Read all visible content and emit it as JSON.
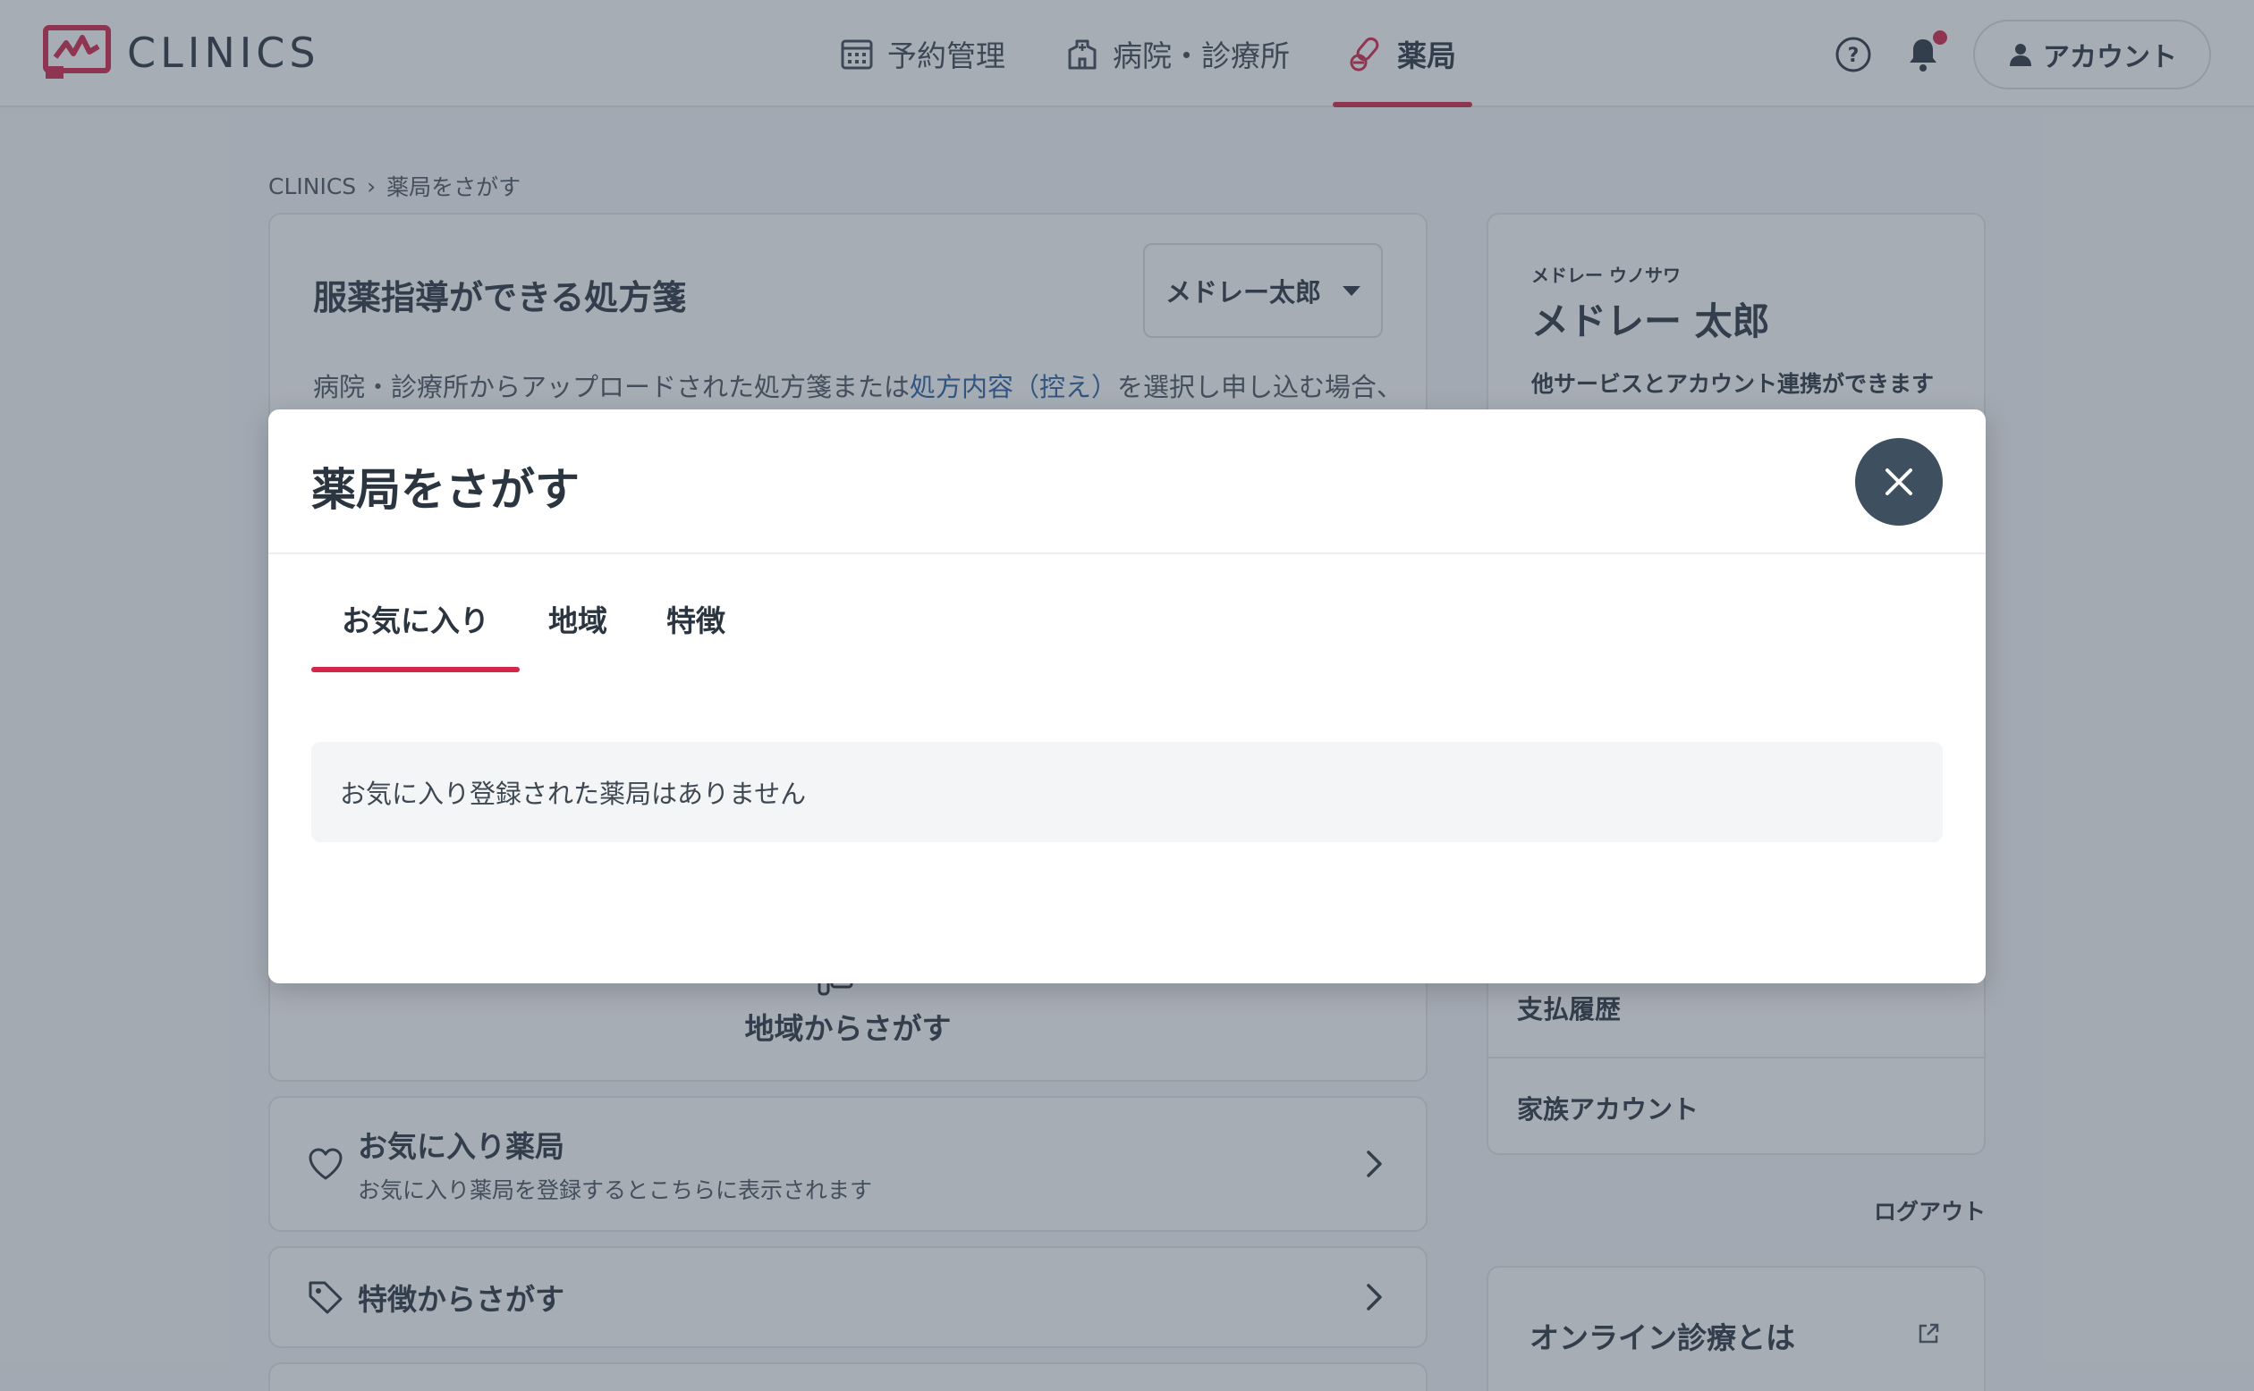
{
  "header": {
    "logo_text": "CLINICS",
    "nav": [
      {
        "label": "予約管理",
        "icon": "calendar-icon"
      },
      {
        "label": "病院・診療所",
        "icon": "hospital-icon"
      },
      {
        "label": "薬局",
        "icon": "pill-icon",
        "active": true
      }
    ],
    "account_label": "アカウント"
  },
  "breadcrumb": {
    "home": "CLINICS",
    "separator": "›",
    "current": "薬局をさがす"
  },
  "main": {
    "title": "服薬指導ができる処方箋",
    "member_select": "メドレー太郎",
    "desc_before": "病院・診療所からアップロードされた処方箋または",
    "desc_link": "処方内容（控え）",
    "desc_after": "を選択し申し込む場合、",
    "area_search": "地域からさがす",
    "favorites_title": "お気に入り薬局",
    "favorites_sub": "お気に入り薬局を登録するとこちらに表示されます",
    "features_title": "特徴からさがす"
  },
  "side": {
    "kana": "メドレー ウノサワ",
    "name": "メドレー 太郎",
    "link_text": "他サービスとアカウント連携ができます",
    "payment_history": "支払履歴",
    "family_account": "家族アカウント",
    "logout": "ログアウト",
    "online_title": "オンライン診療とは"
  },
  "modal": {
    "title": "薬局をさがす",
    "tabs": [
      {
        "label": "お気に入り",
        "active": true
      },
      {
        "label": "地域"
      },
      {
        "label": "特徴"
      }
    ],
    "empty_message": "お気に入り登録された薬局はありません"
  },
  "colors": {
    "accent": "#d2264a",
    "text": "#2b3540",
    "link": "#2b5fa0"
  }
}
